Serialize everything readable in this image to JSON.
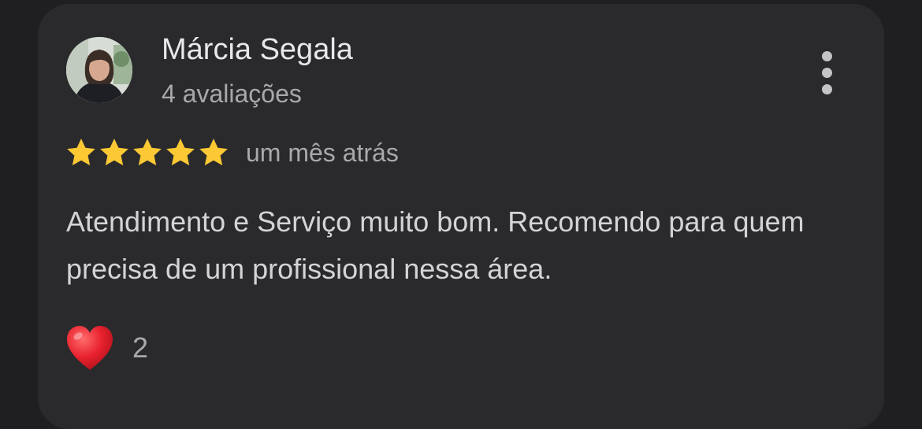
{
  "review": {
    "author_name": "Márcia Segala",
    "author_reviews": "4 avaliações",
    "rating": 5,
    "rating_max": 5,
    "time_ago": "um mês atrás",
    "text": "Atendimento e Serviço muito bom. Recomendo para quem precisa de um profissional nessa área.",
    "reaction_icon": "heart-icon",
    "reaction_count": "2",
    "more_icon": "more-vertical-icon"
  },
  "colors": {
    "background": "#1f1f21",
    "card": "#2a2a2d",
    "star": "#fcc934",
    "heart": "#e8222e"
  }
}
